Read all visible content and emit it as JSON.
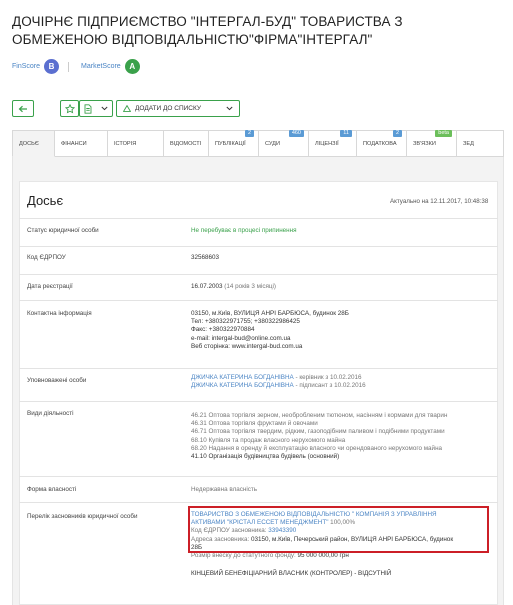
{
  "company": {
    "title_line1": "ДОЧІРНЄ ПІДПРИЄМСТВО \"ІНТЕРГАЛ-БУД\" ТОВАРИСТВА З",
    "title_line2": "ОБМЕЖЕНОЮ ВІДПОВІДАЛЬНІСТЮ\"ФІРМА\"ІНТЕРГАЛ\""
  },
  "scores": {
    "finscore_label": "FinScore",
    "finscore_value": "B",
    "finscore_color": "#5b6fd0",
    "marketscore_label": "MarketScore",
    "marketscore_value": "A",
    "marketscore_color": "#3aa14b"
  },
  "toolbar": {
    "back_icon": "arrow-left-icon",
    "favorite_icon": "star-icon",
    "export_icon": "document-icon",
    "add_to_list_label": "ДОДАТИ ДО СПИСКУ"
  },
  "tabs": [
    {
      "label": "ДОСЬЄ",
      "count": "",
      "active": true
    },
    {
      "label": "ФІНАНСИ",
      "count": ""
    },
    {
      "label": "ІСТОРІЯ",
      "count": ""
    },
    {
      "label": "ВІДОМОСТІ",
      "count": ""
    },
    {
      "label": "ПУБЛІКАЦІЇ",
      "count": "2"
    },
    {
      "label": "СУДИ",
      "count": "460"
    },
    {
      "label": "ЛІЦЕНЗІЇ",
      "count": "11"
    },
    {
      "label": "ПОДАТКОВА",
      "count": "2"
    },
    {
      "label": "ЗВ'ЯЗКИ",
      "count": "beta"
    },
    {
      "label": "ЗЕД",
      "count": ""
    }
  ],
  "dossier": {
    "title": "Досьє",
    "updated": "Актуально на 12.11.2017, 10:48:38",
    "rows": {
      "status_label": "Статус юридичної особи",
      "status_value": "Не перебуває в процесі припинення",
      "edrpou_label": "Код ЄДРПОУ",
      "edrpou_value": "32568603",
      "reg_date_label": "Дата реєстрації",
      "reg_date_value": "16.07.2003",
      "reg_date_age": "(14 років 3 місяці)",
      "contact_label": "Контактна інформація",
      "contact_address": "03150, м.Київ, ВУЛИЦЯ АНРІ БАРБЮСА, будинок 28Б",
      "contact_phone": "Тел: +380322971755; +380322986425",
      "contact_fax": "Факс: +380322970884",
      "contact_email": "e-mail: intergal-bud@online.com.ua",
      "contact_web": "Веб сторінка: www.intergal-bud.com.ua",
      "authorized_label": "Уповноважені особи",
      "authorized_1_name": "ДЖИЧКА КАТЕРИНА БОГДАНІВНА",
      "authorized_1_role": " - керівник з 10.02.2016",
      "authorized_2_name": "ДЖИЧКА КАТЕРИНА БОГДАНІВНА",
      "authorized_2_role": " - підписант з 10.02.2016",
      "activities_label": "Види діяльності",
      "activity_1": "46.21 Оптова торгівля зерном, необробленим тютюном, насінням і кормами для тварин",
      "activity_2": "46.31 Оптова торгівля фруктами й овочами",
      "activity_3": "46.71 Оптова торгівля твердим, рідким, газоподібним паливом і подібними продуктами",
      "activity_4": "68.10 Купівля та продаж власного нерухомого майна",
      "activity_5": "68.20 Надання в оренду й експлуатацію власного чи орендованого нерухомого майна",
      "activity_6": "41.10 Організація будівництва будівель (основний)",
      "ownership_label": "Форма власності",
      "ownership_value": "Недержавна власність",
      "founders_label": "Перелік засновників юридичної особи",
      "founder_name_1": "ТОВАРИСТВО З ОБМЕЖЕНОЮ ВІДПОВІДАЛЬНІСТЮ \" КОМПАНІЯ З УПРАВЛІННЯ",
      "founder_name_2": "АКТИВАМИ \"КРІСТАЛ ЕССЕТ МЕНЕДЖМЕНТ\"",
      "founder_share": " 100,00%",
      "founder_code_label": "Код ЄДРПОУ засновника: ",
      "founder_code": "33943390",
      "founder_addr_label": "Адреса засновника: ",
      "founder_addr_1": "03150, м.Київ, Печерський район, ВУЛИЦЯ АНРІ БАРБЮСА, будинок",
      "founder_addr_2": "28Б",
      "capital_label": "Розмір внеску до статутного фонду: ",
      "capital_value": "95 000 000,00 грн",
      "beneficiary": "КІНЦЕВИЙ БЕНЕФІЦІАРНИЙ ВЛАСНИК (КОНТРОЛЕР) - ВІДСУТНІЙ"
    }
  }
}
